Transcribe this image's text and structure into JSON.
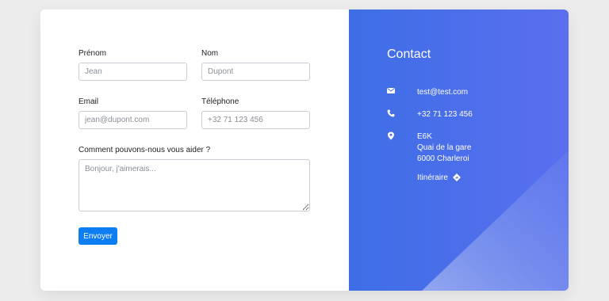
{
  "form": {
    "first_name": {
      "label": "Prénom",
      "placeholder": "Jean"
    },
    "last_name": {
      "label": "Nom",
      "placeholder": "Dupont"
    },
    "email": {
      "label": "Email",
      "placeholder": "jean@dupont.com"
    },
    "phone": {
      "label": "Téléphone",
      "placeholder": "+32 71 123 456"
    },
    "message": {
      "label": "Comment pouvons-nous vous aider ?",
      "placeholder": "Bonjour, j'aimerais..."
    },
    "submit_label": "Envoyer"
  },
  "contact": {
    "title": "Contact",
    "email": "test@test.com",
    "phone": "+32 71 123 456",
    "address": [
      "E6K",
      "Quai de la gare",
      "6000 Charleroi"
    ],
    "route_label": "Itinéraire"
  },
  "colors": {
    "accent": "#0d7df3",
    "panel_start": "#3d6ee6",
    "panel_end": "#5a6ff0",
    "background": "#ececec"
  },
  "icons": {
    "email": "envelope-icon",
    "phone": "phone-icon",
    "address": "map-pin-icon",
    "route": "directions-icon"
  }
}
